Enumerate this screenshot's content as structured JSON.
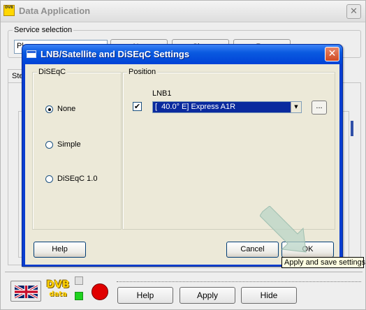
{
  "parent": {
    "title": "Data Application",
    "close_glyph": "✕",
    "service_selection": {
      "label": "Service selection",
      "value": "Pl...",
      "buttons": [
        "N...",
        "Sh...",
        "R..."
      ]
    },
    "tab_label": "Ste"
  },
  "dialog": {
    "title": "LNB/Satellite and DiSEqC Settings",
    "close_glyph": "✕",
    "diseqc": {
      "label": "DiSEqC",
      "options": [
        {
          "label": "None",
          "checked": true
        },
        {
          "label": "Simple",
          "checked": false
        },
        {
          "label": "DiSEqC 1.0",
          "checked": false
        }
      ]
    },
    "position": {
      "label": "Position",
      "lnb_label": "LNB1",
      "lnb_enabled": true,
      "check_glyph": "✔",
      "lnb_value": "[  40.0° E] Express A1R",
      "arrow_glyph": "▼",
      "browse_label": "..."
    },
    "buttons": {
      "help": "Help",
      "cancel": "Cancel",
      "ok": "OK"
    }
  },
  "tooltip": "Apply and save settings",
  "footer": {
    "logo_top": "DVB",
    "logo_bottom": "data",
    "help": "Help",
    "apply": "Apply",
    "hide": "Hide"
  },
  "colors": {
    "dialog_title_blue": "#0a5ae0",
    "selection_blue": "#0a2a9e",
    "tooltip_bg": "#ffffe1",
    "led_green": "#1fd31f",
    "record_red": "#e00000"
  }
}
